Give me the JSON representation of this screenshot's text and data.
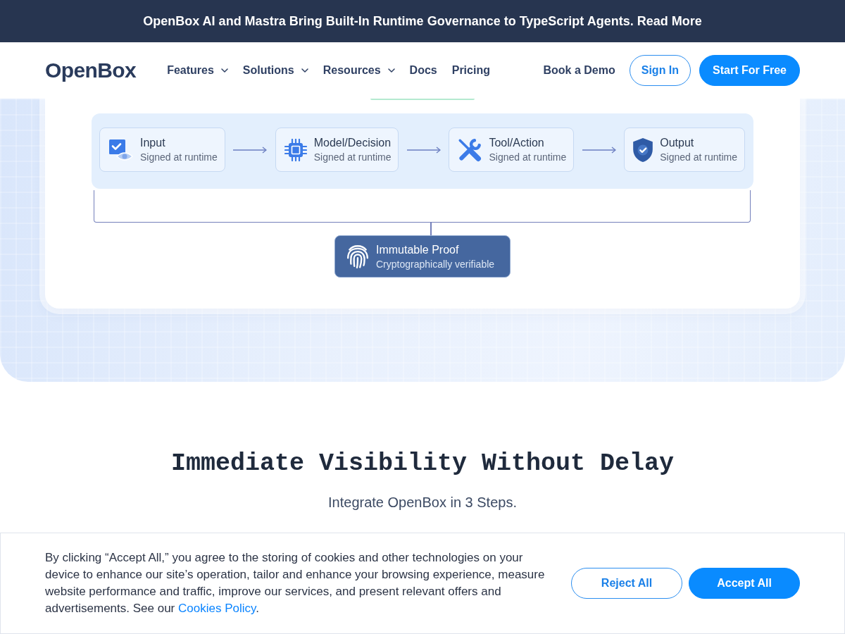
{
  "announcement": {
    "text": "OpenBox AI and Mastra Bring Built-In Runtime Governance to TypeScript Agents. Read More"
  },
  "header": {
    "logo": "OpenBox",
    "nav": [
      {
        "label": "Features",
        "kind": "dropdown"
      },
      {
        "label": "Solutions",
        "kind": "dropdown"
      },
      {
        "label": "Resources",
        "kind": "dropdown"
      },
      {
        "label": "Docs",
        "kind": "link"
      },
      {
        "label": "Pricing",
        "kind": "link"
      }
    ],
    "actions": [
      {
        "label": "Book a Demo",
        "kind": "text"
      },
      {
        "label": "Sign In",
        "kind": "outline"
      },
      {
        "label": "Start For Free",
        "kind": "filled"
      }
    ]
  },
  "flow_diagram": {
    "steps": [
      {
        "kind": "input",
        "title": "Input",
        "subtitle": "Signed at runtime"
      },
      {
        "kind": "model",
        "title": "Model/Decision",
        "subtitle": "Signed at runtime"
      },
      {
        "kind": "tool",
        "title": "Tool/Action",
        "subtitle": "Signed at runtime"
      },
      {
        "kind": "output",
        "title": "Output",
        "subtitle": "Signed at runtime"
      }
    ],
    "proof": {
      "title": "Immutable Proof",
      "subtitle": "Cryptographically verifiable"
    }
  },
  "section": {
    "heading": "Immediate Visibility Without Delay",
    "subheading": "Integrate OpenBox in 3 Steps."
  },
  "cookie_banner": {
    "text": "By clicking “Accept All,” you agree to the storing of cookies and other technologies on your device to enhance our site’s operation, tailor and enhance your browsing experience, measure website performance and traffic, improve our services, and present relevant offers and advertisements. See our",
    "link": "Cookies Policy",
    "text_after": ".",
    "buttons": [
      {
        "label": "Reject All",
        "kind": "outline"
      },
      {
        "label": "Accept All",
        "kind": "filled"
      }
    ]
  }
}
